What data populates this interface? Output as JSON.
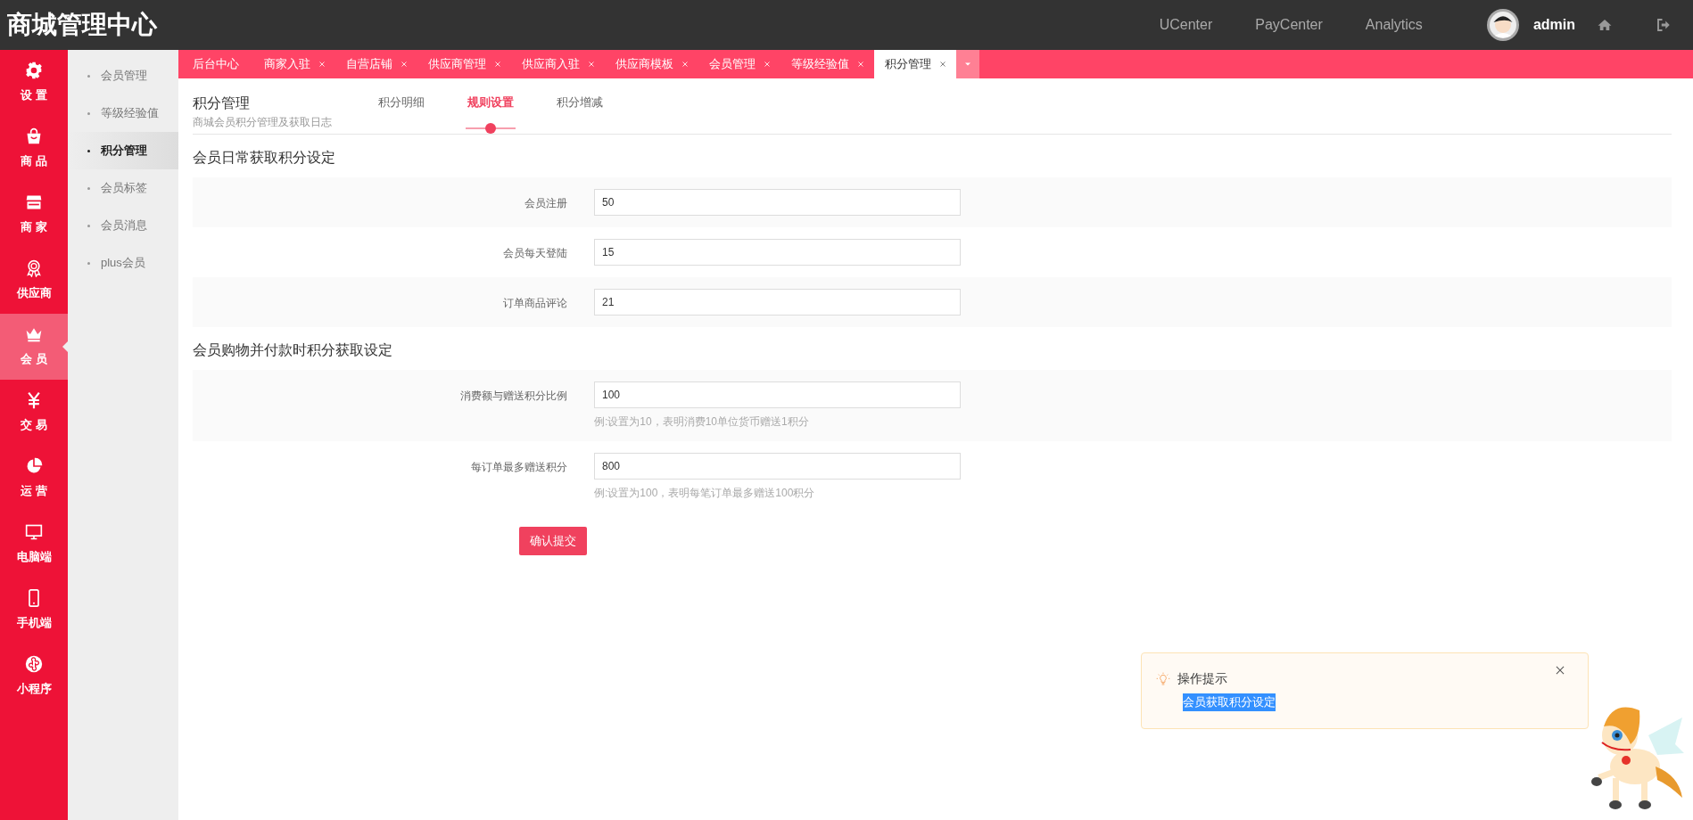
{
  "header": {
    "title": "商城管理中心",
    "links": [
      "UCenter",
      "PayCenter",
      "Analytics"
    ],
    "user": "admin"
  },
  "sidebar": {
    "items": [
      {
        "label": "设 置",
        "selected": false
      },
      {
        "label": "商 品",
        "selected": false
      },
      {
        "label": "商 家",
        "selected": false
      },
      {
        "label": "供应商",
        "selected": false
      },
      {
        "label": "会 员",
        "selected": true
      },
      {
        "label": "交 易",
        "selected": false
      },
      {
        "label": "运 营",
        "selected": false
      },
      {
        "label": "电脑端",
        "selected": false
      },
      {
        "label": "手机端",
        "selected": false
      },
      {
        "label": "小程序",
        "selected": false
      }
    ]
  },
  "submenu": {
    "items": [
      {
        "label": "会员管理",
        "selected": false
      },
      {
        "label": "等级经验值",
        "selected": false
      },
      {
        "label": "积分管理",
        "selected": true
      },
      {
        "label": "会员标签",
        "selected": false
      },
      {
        "label": "会员消息",
        "selected": false
      },
      {
        "label": "plus会员",
        "selected": false
      }
    ]
  },
  "tabs": [
    {
      "label": "后台中心",
      "closable": false,
      "selected": false
    },
    {
      "label": "商家入驻",
      "closable": true,
      "selected": false
    },
    {
      "label": "自营店铺",
      "closable": true,
      "selected": false
    },
    {
      "label": "供应商管理",
      "closable": true,
      "selected": false
    },
    {
      "label": "供应商入驻",
      "closable": true,
      "selected": false
    },
    {
      "label": "供应商模板",
      "closable": true,
      "selected": false
    },
    {
      "label": "会员管理",
      "closable": true,
      "selected": false
    },
    {
      "label": "等级经验值",
      "closable": true,
      "selected": false
    },
    {
      "label": "积分管理",
      "closable": true,
      "selected": true
    }
  ],
  "page": {
    "title": "积分管理",
    "subtitle": "商城会员积分管理及获取日志",
    "subtabs": [
      {
        "label": "积分明细",
        "selected": false
      },
      {
        "label": "规则设置",
        "selected": true
      },
      {
        "label": "积分增减",
        "selected": false
      }
    ],
    "sections": [
      {
        "title": "会员日常获取积分设定",
        "fields": [
          {
            "label": "会员注册",
            "value": "50"
          },
          {
            "label": "会员每天登陆",
            "value": "15"
          },
          {
            "label": "订单商品评论",
            "value": "21"
          }
        ]
      },
      {
        "title": "会员购物并付款时积分获取设定",
        "fields": [
          {
            "label": "消费额与赠送积分比例",
            "value": "100",
            "hint": "例:设置为10，表明消费10单位货币赠送1积分"
          },
          {
            "label": "每订单最多赠送积分",
            "value": "800",
            "hint": "例:设置为100，表明每笔订单最多赠送100积分"
          }
        ]
      }
    ],
    "submit": "确认提交"
  },
  "tip": {
    "title": "操作提示",
    "text": "会员获取积分设定",
    "highlighted": true
  }
}
